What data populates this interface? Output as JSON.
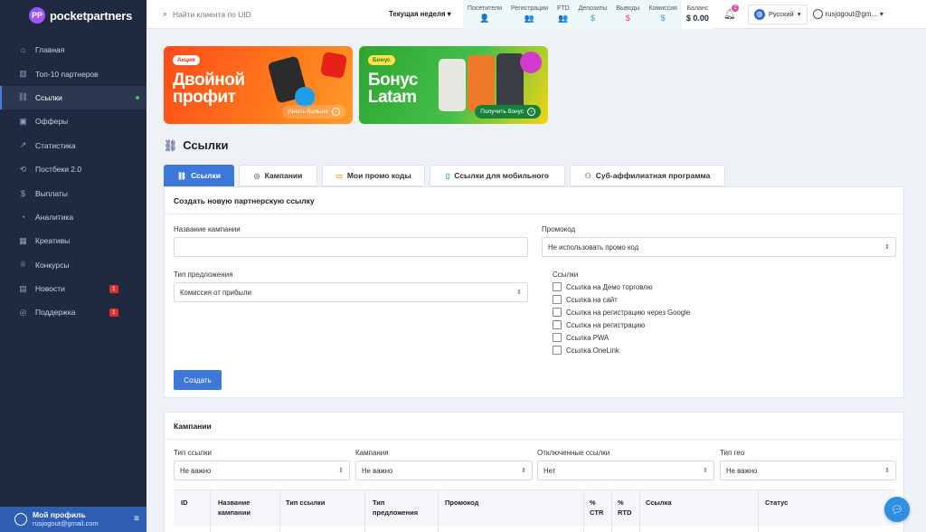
{
  "brand": {
    "name": "pocketpartners"
  },
  "sidebar": {
    "items": [
      {
        "label": "Главная",
        "icon": "home-icon"
      },
      {
        "label": "Топ-10 партнеров",
        "icon": "chart-bars-icon"
      },
      {
        "label": "Ссылки",
        "icon": "link-icon",
        "active": true
      },
      {
        "label": "Офферы",
        "icon": "briefcase-icon"
      },
      {
        "label": "Статистика",
        "icon": "line-chart-icon"
      },
      {
        "label": "Постбеки 2.0",
        "icon": "postback-icon"
      },
      {
        "label": "Выплаты",
        "icon": "dollar-icon"
      },
      {
        "label": "Аналитика",
        "icon": "analytics-icon"
      },
      {
        "label": "Креативы",
        "icon": "image-icon"
      },
      {
        "label": "Конкурсы",
        "icon": "trophy-icon"
      },
      {
        "label": "Новости",
        "icon": "news-icon",
        "badge": "1"
      },
      {
        "label": "Поддержка",
        "icon": "support-icon",
        "badge": "1"
      }
    ],
    "profile": {
      "title": "Мой профиль",
      "email": "rusjogout@gmail.com"
    }
  },
  "topbar": {
    "search_placeholder": "Найти клиента по UID",
    "period": "Текущая неделя",
    "stats": [
      {
        "label": "Посетители",
        "value": "👤",
        "tone": "teal"
      },
      {
        "label": "Регистрации",
        "value": "👥",
        "tone": "teal"
      },
      {
        "label": "FTD",
        "value": "👥",
        "tone": "teal"
      },
      {
        "label": "Депозиты",
        "value": "$",
        "tone": "teal"
      },
      {
        "label": "Выводы",
        "value": "$",
        "tone": "red"
      },
      {
        "label": "Комиссия",
        "value": "$",
        "tone": "teal"
      },
      {
        "label": "Баланс",
        "value": "$ 0.00",
        "tone": "dark"
      }
    ],
    "notifications": "2",
    "language": "Русский",
    "user": "rusjogout@gm..."
  },
  "banners": [
    {
      "tag": "Акция",
      "title": "Двойной профит",
      "button": "Узнать больше"
    },
    {
      "tag": "Бонус",
      "title": "Бонус Latam",
      "button": "Получить бонус"
    }
  ],
  "page": {
    "title": "Ссылки"
  },
  "tabs": [
    {
      "label": "Ссылки",
      "active": true
    },
    {
      "label": "Кампании"
    },
    {
      "label": "Мои промо коды"
    },
    {
      "label": "Ссылки для мобильного"
    },
    {
      "label": "Суб-аффилиатная программа"
    }
  ],
  "create_form": {
    "title": "Создать новую партнерскую ссылку",
    "campaign_name_label": "Название кампании",
    "campaign_name_value": "",
    "promo_label": "Промокод",
    "promo_value": "Не использовать промо код",
    "offer_type_label": "Тип предложения",
    "offer_type_value": "Комиссия от прибыли",
    "links_label": "Ссылки",
    "links": [
      {
        "label": "Ссылка на Демо торговлю",
        "checked": false
      },
      {
        "label": "Ссылка на сайт",
        "checked": false
      },
      {
        "label": "Ссылка на регистрацию через Google",
        "checked": false
      },
      {
        "label": "Ссылка на регистрацию",
        "checked": false
      },
      {
        "label": "Ссылка PWA",
        "checked": false
      },
      {
        "label": "Ссылка OneLink",
        "checked": false
      }
    ],
    "submit": "Создать"
  },
  "campaigns": {
    "title": "Кампании",
    "filters": [
      {
        "label": "Тип ссылки",
        "value": "Не важно"
      },
      {
        "label": "Кампания",
        "value": "Не важно"
      },
      {
        "label": "Отключенные ссылки",
        "value": "Нет"
      },
      {
        "label": "Тип гео",
        "value": "Не важно"
      }
    ],
    "columns": [
      "ID",
      "Название кампании",
      "Тип ссылки",
      "Тип предложения",
      "Промокод",
      "% CTR",
      "% RTD",
      "Ссылка",
      "Статус"
    ]
  }
}
